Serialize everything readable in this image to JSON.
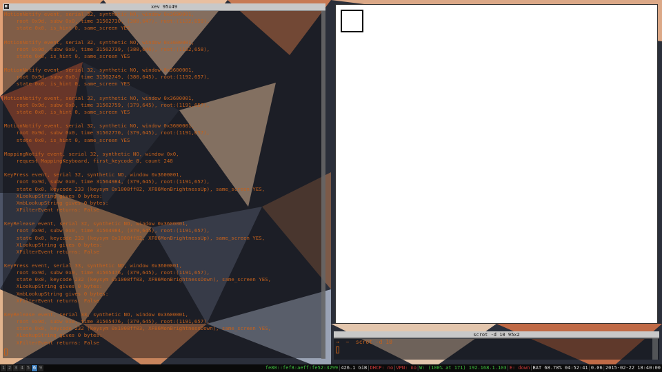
{
  "xev_window": {
    "title": "xev 95x49",
    "output_lines": [
      "MotionNotify event, serial 32, synthetic NO, window 0x3600001,",
      "    root 0x9d, subw 0x0, time 31562730, (380,647), root:(1192,659),",
      "    state 0x0, is_hint 0, same_screen YES",
      "",
      "MotionNotify event, serial 32, synthetic NO, window 0x3600001,",
      "    root 0x9d, subw 0x0, time 31562739, (380,646), root:(1192,658),",
      "    state 0x0, is_hint 0, same_screen YES",
      "",
      "MotionNotify event, serial 32, synthetic NO, window 0x3600001,",
      "    root 0x9d, subw 0x0, time 31562749, (380,645), root:(1192,657),",
      "    state 0x0, is_hint 0, same_screen YES",
      "",
      "MotionNotify event, serial 32, synthetic NO, window 0x3600001,",
      "    root 0x9d, subw 0x0, time 31562759, (379,645), root:(1191,657),",
      "    state 0x0, is_hint 0, same_screen YES",
      "",
      "MotionNotify event, serial 32, synthetic NO, window 0x3600001,",
      "    root 0x9d, subw 0x0, time 31562770, (379,645), root:(1191,657),",
      "    state 0x0, is_hint 0, same_screen YES",
      "",
      "MappingNotify event, serial 32, synthetic NO, window 0x0,",
      "    request MappingKeyboard, first_keycode 8, count 248",
      "",
      "KeyPress event, serial 32, synthetic NO, window 0x3600001,",
      "    root 0x9d, subw 0x0, time 31564984, (379,645), root:(1191,657),",
      "    state 0x0, keycode 233 (keysym 0x1008ff02, XF86MonBrightnessUp), same_screen YES,",
      "    XLookupString gives 0 bytes:",
      "    XmbLookupString gives 0 bytes:",
      "    XFilterEvent returns: False",
      "",
      "KeyRelease event, serial 32, synthetic NO, window 0x3600001,",
      "    root 0x9d, subw 0x0, time 31564984, (379,645), root:(1191,657),",
      "    state 0x0, keycode 233 (keysym 0x1008ff02, XF86MonBrightnessUp), same_screen YES,",
      "    XLookupString gives 0 bytes:",
      "    XFilterEvent returns: False",
      "",
      "KeyPress event, serial 33, synthetic NO, window 0x3600001,",
      "    root 0x9d, subw 0x0, time 31565476, (379,645), root:(1191,657),",
      "    state 0x0, keycode 232 (keysym 0x1008ff03, XF86MonBrightnessDown), same_screen YES,",
      "    XLookupString gives 0 bytes:",
      "    XmbLookupString gives 0 bytes:",
      "    XFilterEvent returns: False",
      "",
      "KeyRelease event, serial 33, synthetic NO, window 0x3600001,",
      "    root 0x9d, subw 0x0, time 31565476, (379,645), root:(1191,657),",
      "    state 0x0, keycode 232 (keysym 0x1008ff03, XF86MonBrightnessDown), same_screen YES,",
      "    XLookupString gives 0 bytes:",
      "    XFilterEvent returns: False"
    ]
  },
  "scrot_window": {
    "title": "scrot -d 10 95x2",
    "prompt": "→  ~  scrot -d 10"
  },
  "statusbar": {
    "workspaces": [
      "1",
      "2",
      "3",
      "4",
      "5",
      "6",
      "9"
    ],
    "active_workspace": "6",
    "segments": [
      {
        "text": "fe80::fef8:aeff:fe52:3299",
        "color": "green"
      },
      {
        "text": "426.1 GiB",
        "color": "white"
      },
      {
        "text": "DHCP: no",
        "color": "red"
      },
      {
        "text": "VPN: no",
        "color": "red"
      },
      {
        "text": "W: (100% at 171) 192.168.1.103",
        "color": "green"
      },
      {
        "text": "E: down",
        "color": "red"
      },
      {
        "text": "BAT 68.78% 04:52:41",
        "color": "white"
      },
      {
        "text": "0.06",
        "color": "white"
      },
      {
        "text": "2015-02-22 18:40:00",
        "color": "white"
      }
    ]
  },
  "colors": {
    "terminal_fg": "#c5611c",
    "active_workspace": "#3a78b5",
    "status_green": "#3fbf3f",
    "status_red": "#d23a3a"
  },
  "icons": [
    "window-menu-icon",
    "square-glyph-icon"
  ]
}
